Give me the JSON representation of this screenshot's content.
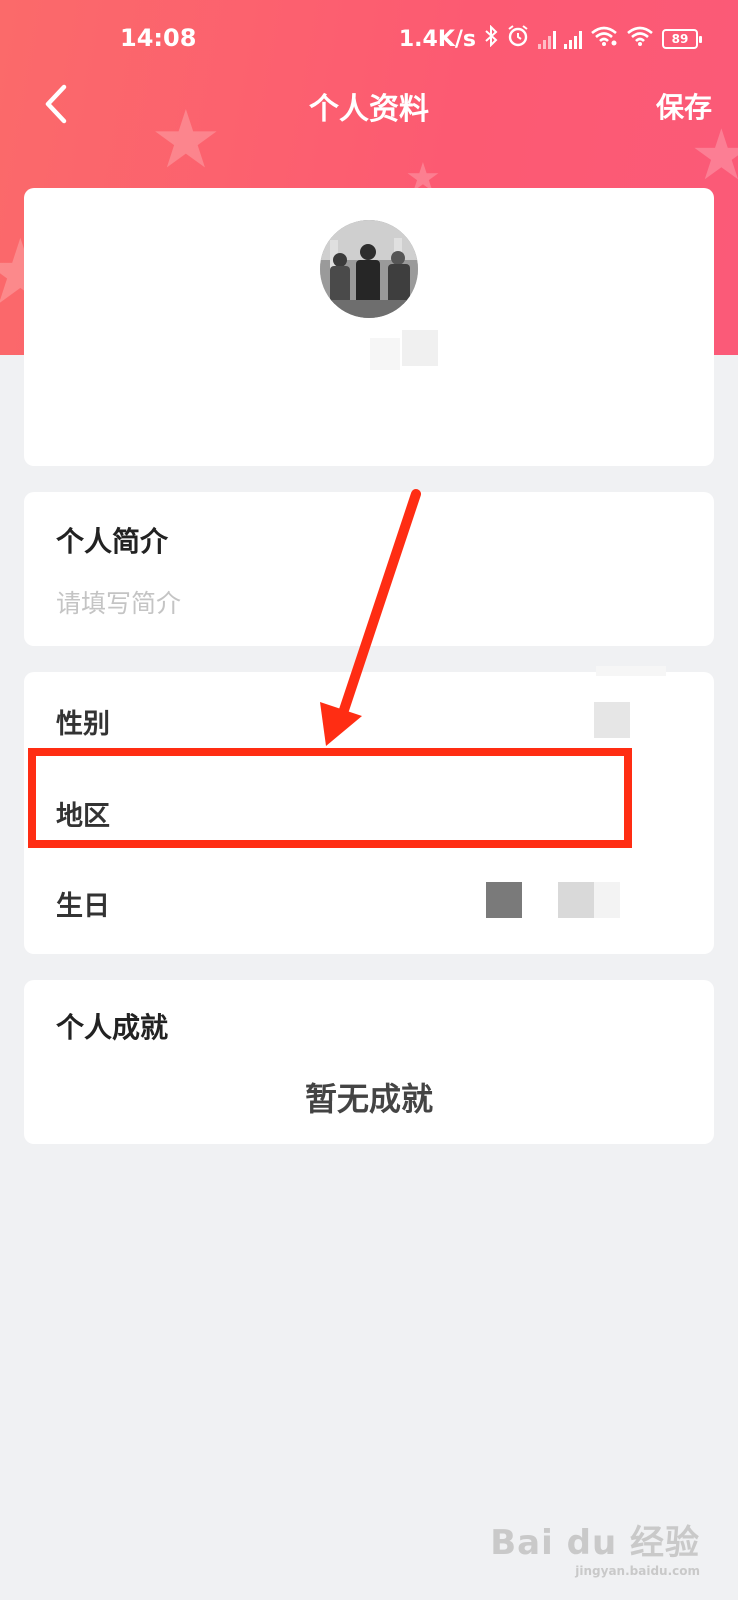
{
  "status_bar": {
    "time": "14:08",
    "network_speed": "1.4K/s",
    "battery_level": "89",
    "icons": [
      "bluetooth-icon",
      "alarm-icon",
      "signal-icon",
      "signal-icon",
      "wifi-icon",
      "wifi-icon",
      "battery-icon"
    ]
  },
  "nav": {
    "back_icon": "chevron-left-icon",
    "title": "个人资料",
    "save_label": "保存"
  },
  "profile": {
    "avatar_icon": "avatar-photo"
  },
  "bio": {
    "title": "个人简介",
    "placeholder": "请填写简介"
  },
  "info": {
    "gender_label": "性别",
    "region_label": "地区",
    "birthday_label": "生日"
  },
  "achievements": {
    "title": "个人成就",
    "empty_text": "暂无成就"
  },
  "watermark": {
    "main": "Bai du 经验",
    "sub": "jingyan.baidu.com"
  },
  "colors": {
    "header_gradient_start": "#fb6a6a",
    "header_gradient_end": "#fb5a78",
    "annotation_red": "#ff2d13",
    "page_bg": "#f0f1f3"
  }
}
